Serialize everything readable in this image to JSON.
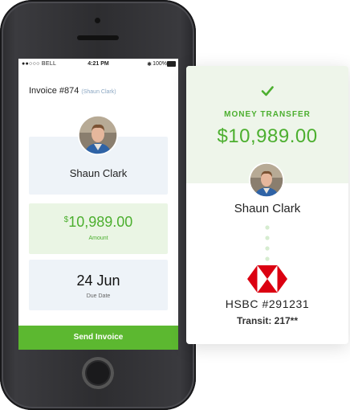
{
  "status_bar": {
    "carrier": "●●○○○ BELL",
    "time": "4:21 PM",
    "bluetooth": "✱",
    "battery": "100%"
  },
  "invoice": {
    "title": "Invoice #874",
    "client_tag": "(Shaun Clark)",
    "client_name": "Shaun Clark",
    "currency_symbol": "$",
    "amount": "10,989.00",
    "amount_label": "Amount",
    "due_date": "24 Jun",
    "due_date_label": "Due Date",
    "send_button": "Send Invoice"
  },
  "transfer_card": {
    "label": "MONEY TRANSFER",
    "amount": "$10,989.00",
    "recipient": "Shaun Clark",
    "bank": "HSBC  #291231",
    "transit": "Transit: 217**"
  },
  "icons": {
    "check": "check-icon",
    "bank_logo": "hsbc-logo",
    "avatar": "avatar"
  },
  "colors": {
    "accent_green": "#5cb830",
    "text_green": "#4caf2f",
    "panel_blue": "#eef3f8",
    "panel_green": "#eaf5e4",
    "bank_red": "#db0011"
  }
}
